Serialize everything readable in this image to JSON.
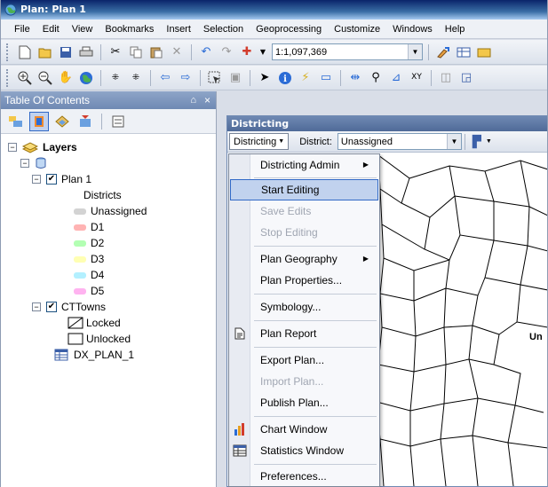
{
  "window": {
    "title": "Plan: Plan 1"
  },
  "menubar": [
    "File",
    "Edit",
    "View",
    "Bookmarks",
    "Insert",
    "Selection",
    "Geoprocessing",
    "Customize",
    "Windows",
    "Help"
  ],
  "toolbar": {
    "scale": "1:1,097,369"
  },
  "toc": {
    "title": "Table Of Contents",
    "pin": "⌂",
    "close": "×",
    "root": "Layers",
    "layers": [
      {
        "name": "Plan 1",
        "checked": "✔"
      },
      {
        "name": "CTTowns",
        "checked": "✔"
      }
    ],
    "districts_heading": "Districts",
    "districts": [
      {
        "label": "Unassigned",
        "color": "#d3d3d3"
      },
      {
        "label": "D1",
        "color": "#ffb3b3"
      },
      {
        "label": "D2",
        "color": "#b3ffb3"
      },
      {
        "label": "D3",
        "color": "#ffffb3"
      },
      {
        "label": "D4",
        "color": "#b3f0ff"
      },
      {
        "label": "D5",
        "color": "#ffb3f0"
      }
    ],
    "towns_legend": [
      "Locked",
      "Unlocked"
    ],
    "table": "DX_PLAN_1"
  },
  "districting": {
    "title": "Districting",
    "menu_button": "Districting",
    "district_label": "District:",
    "district_value": "Unassigned",
    "map_label": "Un"
  },
  "dropdown": {
    "items": [
      {
        "label": "Districting Admin"
      },
      {
        "label": "Start Editing"
      },
      {
        "label": "Save Edits"
      },
      {
        "label": "Stop Editing"
      },
      {
        "label": "Plan Geography"
      },
      {
        "label": "Plan Properties..."
      },
      {
        "label": "Symbology..."
      },
      {
        "label": "Plan Report"
      },
      {
        "label": "Export Plan..."
      },
      {
        "label": "Import Plan..."
      },
      {
        "label": "Publish Plan..."
      },
      {
        "label": "Chart Window"
      },
      {
        "label": "Statistics Window"
      },
      {
        "label": "Preferences..."
      }
    ]
  },
  "colors": {
    "menu_highlight": "#c1d2ee",
    "highlight_border": "#3169c6",
    "titlebar": "#0a246a"
  }
}
